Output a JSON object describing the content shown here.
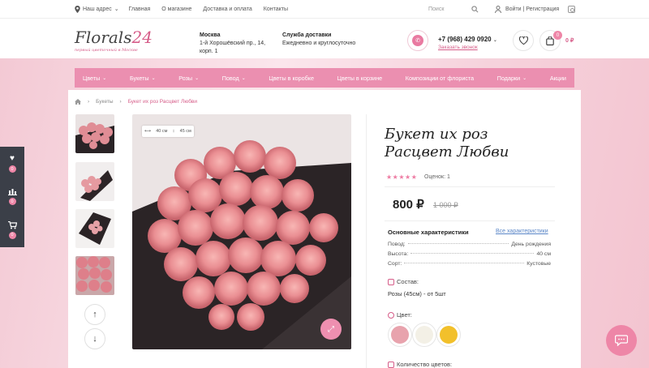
{
  "topbar": {
    "location": "Наш адрес",
    "nav": [
      "Главная",
      "О магазине",
      "Доставка и оплата",
      "Контакты"
    ],
    "search_placeholder": "Поиск",
    "login": "Войти | Регистрация"
  },
  "header": {
    "logo": {
      "brand": "Florals",
      "num": "24",
      "tagline": "первый цветочный в Москве"
    },
    "address": {
      "title": "Москва",
      "line1": "1-й Хорошёвский пр., 14,",
      "line2": "корп. 1"
    },
    "delivery": {
      "title": "Служба доставки",
      "text": "Ежедневно и круглосуточно"
    },
    "phone": "+7 (968) 429 0920",
    "callback": "Заказать звонок",
    "cart_count": "0",
    "cart_total": "0 ₽"
  },
  "menu": [
    {
      "label": "Цветы",
      "caret": true
    },
    {
      "label": "Букеты",
      "caret": true
    },
    {
      "label": "Розы",
      "caret": true
    },
    {
      "label": "Повод",
      "caret": true
    },
    {
      "label": "Цветы в коробке",
      "caret": false
    },
    {
      "label": "Цветы в корзине",
      "caret": false
    },
    {
      "label": "Композиции от флориста",
      "caret": false
    },
    {
      "label": "Подарки",
      "caret": true
    },
    {
      "label": "Акции",
      "caret": false
    }
  ],
  "breadcrumbs": [
    "Букеты",
    "Букет их роз Расцвет Любви"
  ],
  "product": {
    "title": "Букет их роз Расцвет Любви",
    "stars": "★★★★★",
    "rating": "Оценок: 1",
    "price": "800 ₽",
    "old_price": "1 000 ₽",
    "dims": {
      "width": "40 см",
      "height": "45 см"
    },
    "characteristics_title": "Основные характеристики",
    "characteristics_all": "Все характеристики",
    "characteristics": [
      {
        "name": "Повод:",
        "value": "День рождения"
      },
      {
        "name": "Высота:",
        "value": "40 см"
      },
      {
        "name": "Сорт:",
        "value": "Кустовые"
      }
    ],
    "composition_label": "Состав:",
    "composition_value": "Розы (45см) - от 5шт",
    "color_label": "Цвет:",
    "colors": [
      "#e8a3ad",
      "#f3f0e6",
      "#f2c02b"
    ],
    "count_label": "Количество цветов:"
  },
  "sidebar": {
    "favorites_count": "0",
    "compare_count": "0",
    "cart_count": "0"
  }
}
